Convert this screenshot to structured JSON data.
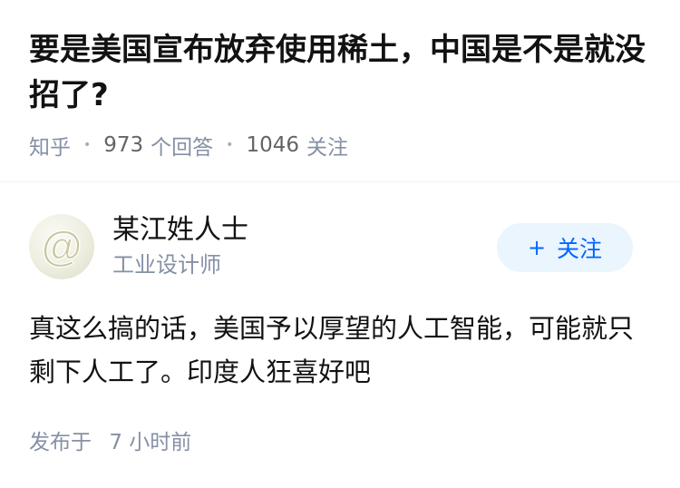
{
  "question": {
    "title": "要是美国宣布放弃使用稀土，中国是不是就没招了?",
    "source": "知乎",
    "answer_count": "973",
    "answer_count_label": "个回答",
    "follower_count": "1046",
    "follower_count_label": "关注"
  },
  "author": {
    "name": "某江姓人士",
    "headline": "工业设计师",
    "avatar_icon": "at-sign-avatar-icon",
    "follow_label": "关注",
    "follow_icon": "+"
  },
  "answer": {
    "content": "真这么搞的话，美国予以厚望的人工智能，可能就只剩下人工了。印度人狂喜好吧",
    "published_prefix": "发布于",
    "published_time": "7 小时前"
  },
  "colors": {
    "title": "#121212",
    "meta": "#8590a6",
    "follow_bg": "#ebf5fd",
    "follow_text": "#0066ff"
  }
}
